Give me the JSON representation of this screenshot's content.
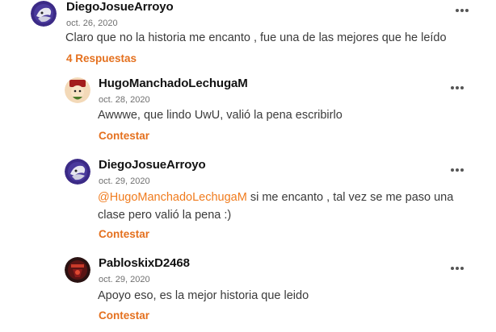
{
  "comments": [
    {
      "author": "DiegoJosueArroyo",
      "date": "oct. 26, 2020",
      "text": "Claro que no la historia me encanto , fue una de las mejores que he leído",
      "action": "4 Respuestas",
      "avatar_icon": "purple-anime-avatar"
    }
  ],
  "replies": [
    {
      "author": "HugoManchadoLechugaM",
      "date": "oct. 28, 2020",
      "text": "Awwwe, que lindo UwU, valió la pena escribirlo",
      "action": "Contestar",
      "avatar_icon": "cartoon-character-avatar"
    },
    {
      "author": "DiegoJosueArroyo",
      "date": "oct. 29, 2020",
      "mention": "@HugoManchadoLechugaM",
      "text": " si me encanto , tal vez se me paso una clase pero valió la pena :)",
      "action": "Contestar",
      "avatar_icon": "purple-anime-avatar"
    },
    {
      "author": "PabloskixD2468",
      "date": "oct. 29, 2020",
      "text": "Apoyo eso, es la mejor historia que leido",
      "action": "Contestar",
      "avatar_icon": "dark-red-logo-avatar"
    }
  ],
  "colors": {
    "accent": "#e4701e",
    "mention": "#f07b1d",
    "avatar_purple": "#3b2a86"
  },
  "icons": {
    "more_options": "more-horizontal-icon"
  }
}
